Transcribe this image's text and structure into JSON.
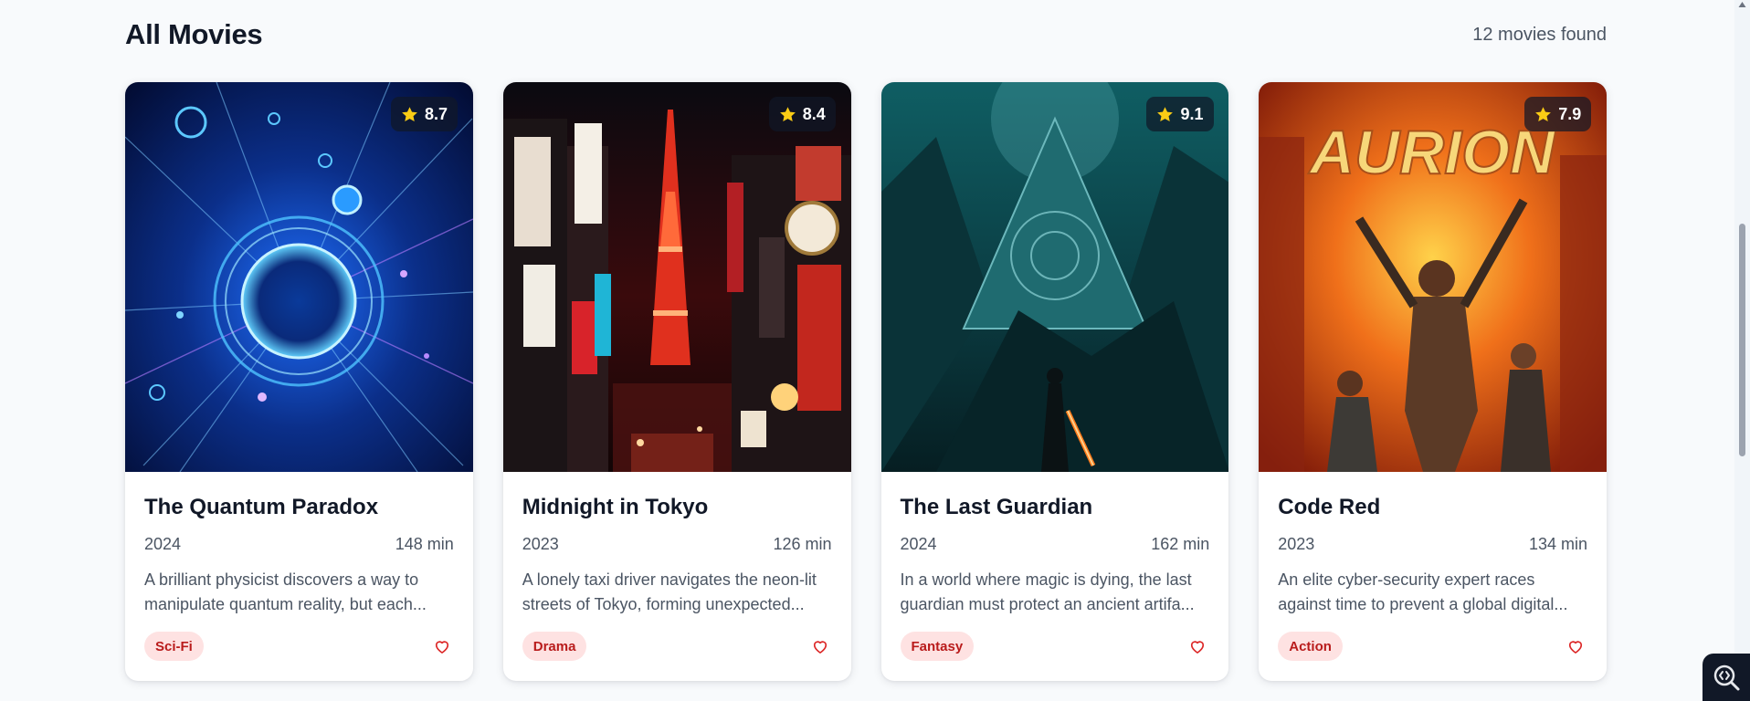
{
  "section": {
    "title": "All Movies",
    "results_count": "12 movies found"
  },
  "colors": {
    "page_background": "#f8fafc",
    "tag_background": "#fee2e2",
    "tag_text": "#b91c1c",
    "star": "#facc15",
    "heart": "#dc2626"
  },
  "movies": [
    {
      "title": "The Quantum Paradox",
      "rating": "8.7",
      "year": "2024",
      "duration": "148 min",
      "description": "A brilliant physicist discovers a way to manipulate quantum reality, but each...",
      "genre": "Sci-Fi",
      "poster": "quantum-portal-poster"
    },
    {
      "title": "Midnight in Tokyo",
      "rating": "8.4",
      "year": "2023",
      "duration": "126 min",
      "description": "A lonely taxi driver navigates the neon-lit streets of Tokyo, forming unexpected...",
      "genre": "Drama",
      "poster": "tokyo-night-poster"
    },
    {
      "title": "The Last Guardian",
      "rating": "9.1",
      "year": "2024",
      "duration": "162 min",
      "description": "In a world where magic is dying, the last guardian must protect an ancient artifa...",
      "genre": "Fantasy",
      "poster": "guardian-mountain-poster"
    },
    {
      "title": "Code Red",
      "rating": "7.9",
      "year": "2023",
      "duration": "134 min",
      "description": "An elite cyber-security expert races against time to prevent a global digital...",
      "genre": "Action",
      "poster": "code-red-poster",
      "poster_text": "AURION"
    }
  ],
  "icons": {
    "rating": "star-icon",
    "favorite": "heart-icon",
    "scroll_up": "chevron-up-icon",
    "floating_tool": "code-search-icon"
  }
}
